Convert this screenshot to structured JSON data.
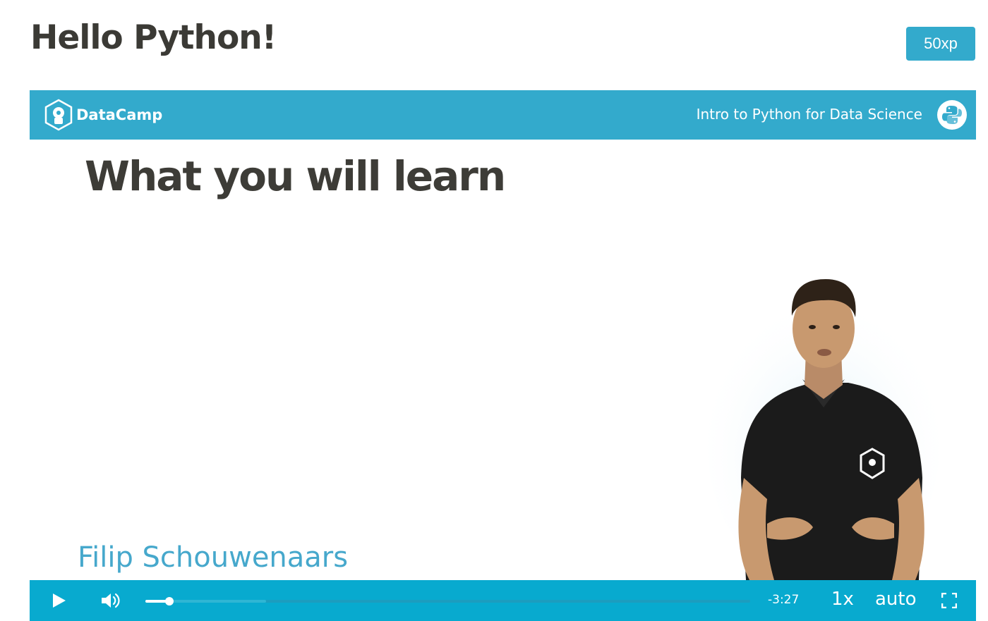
{
  "page": {
    "title": "Hello Python!",
    "xp_badge": "50xp"
  },
  "video": {
    "header": {
      "brand": "DataCamp",
      "course_title": "Intro to Python for Data Science",
      "brand_icon": "datacamp-logo-icon",
      "course_icon": "python-logo-icon"
    },
    "slide": {
      "heading": "What you will learn",
      "presenter_name": "Filip Schouwenaars"
    },
    "controls": {
      "time_remaining": "-3:27",
      "speed": "1x",
      "quality": "auto",
      "progress_fraction": 0.04,
      "buffered_fraction": 0.2
    }
  },
  "colors": {
    "accent": "#33aacc",
    "controls_bar": "#08aacf",
    "presenter_name": "#46a8cc",
    "heading": "#3d3c37"
  }
}
